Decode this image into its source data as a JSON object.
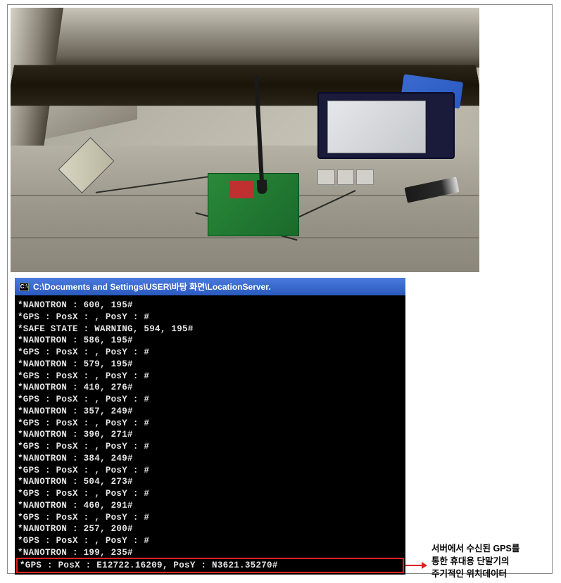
{
  "console": {
    "title_path": "C:\\Documents and Settings\\USER\\바탕 화면\\LocationServer.",
    "icon_char": "C:\\",
    "lines": [
      "*NANOTRON : 600, 195#",
      "*GPS : PosX : , PosY : #",
      "*SAFE STATE : WARNING, 594, 195#",
      "*NANOTRON : 586, 195#",
      "*GPS : PosX : , PosY : #",
      "*NANOTRON : 579, 195#",
      "*GPS : PosX : , PosY : #",
      "*NANOTRON : 410, 276#",
      "*GPS : PosX : , PosY : #",
      "*NANOTRON : 357, 249#",
      "*GPS : PosX : , PosY : #",
      "*NANOTRON : 390, 271#",
      "*GPS : PosX : , PosY : #",
      "*NANOTRON : 384, 249#",
      "*GPS : PosX : , PosY : #",
      "*NANOTRON : 504, 273#",
      "*GPS : PosX : , PosY : #",
      "*NANOTRON : 460, 291#",
      "*GPS : PosX : , PosY : #",
      "*NANOTRON : 257, 200#",
      "*GPS : PosX : , PosY : #",
      "*NANOTRON : 199, 235#"
    ],
    "highlighted_line": "*GPS : PosX : E12722.16209, PosY : N3621.35270#"
  },
  "annotation": {
    "line1": "서버에서 수신된 GPS를",
    "line2": "통한 휴대용 단말기의",
    "line3": "주기적인 위치데이터"
  }
}
